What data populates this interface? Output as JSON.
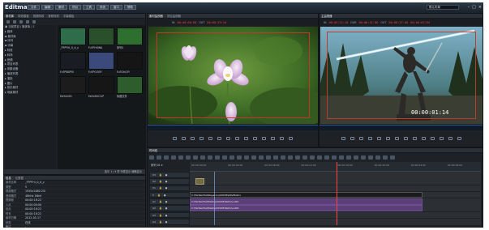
{
  "titlebar": {
    "app_name": "Editmax",
    "menus": [
      "文件",
      "编辑",
      "素材",
      "项目",
      "工具",
      "系统",
      "窗口",
      "帮助"
    ],
    "layout_select": "默认布局",
    "window_controls": [
      "–",
      "□",
      "×"
    ]
  },
  "library": {
    "tabs": [
      "素材库",
      "特效模板",
      "视频特效",
      "音频特效",
      "字幕模板"
    ],
    "tree": [
      "▣ 当前项目 / 媒体库 / 1",
      "  ▸ 媒体",
      "    ▪ 素材库",
      "    ▪ 序列",
      "    ▪ 字幕",
      "  ▸ 特效",
      "  ▸ 转场",
      "  ▸ 音频",
      "▸ 项目列表",
      "▸ 采集设备",
      "▸ 播放列表",
      "▸ 渲染",
      "▸ 图片",
      "▸ 音乐素材",
      "▸ 场景素材"
    ],
    "thumbs": [
      {
        "label": "_P?PFHi_0_d_y",
        "color": "#2f6c4a"
      },
      {
        "label": "Fu?PHi0NA",
        "color": "#2a4f2b"
      },
      {
        "label": "序列1",
        "color": "#2e6e2e"
      },
      {
        "label": "Fu?Pi80Pi0",
        "color": "#1a1c24"
      },
      {
        "label": "Fu?PGi30F",
        "color": "#3b4a7a"
      },
      {
        "label": "Fu?Ghi1Pi",
        "color": "#151515"
      },
      {
        "label": "FaHnhi01",
        "color": "#1c1c1c"
      },
      {
        "label": "FaHnHih21P",
        "color": "#161616"
      },
      {
        "label": "标题文件",
        "color": "#2d5c2d"
      }
    ],
    "status": "选中 1 / 9 项  列表显示  缩略显示"
  },
  "properties": {
    "tabs": [
      "信息",
      "元数据"
    ],
    "rows": [
      {
        "k": "素材名称",
        "v": "_P?PFHi_0_d_y"
      },
      {
        "k": "类型",
        "v": "V"
      },
      {
        "k": "视频格式",
        "v": "1920x1080 25i"
      },
      {
        "k": "音频格式",
        "v": "48kHz 16bit"
      },
      {
        "k": "视频帧",
        "v": "00:00:18:22"
      },
      {
        "k": "入点",
        "v": "00:00:00:00"
      },
      {
        "k": "出点",
        "v": "00:00:18:22"
      },
      {
        "k": "时长",
        "v": "00:00:18:22"
      },
      {
        "k": "素材日期",
        "v": "2012-05-17"
      },
      {
        "k": "状态",
        "v": "在线"
      },
      {
        "k": "备注",
        "v": "-"
      }
    ]
  },
  "source": {
    "tabs": [
      "素材监视器",
      "项目监视器"
    ],
    "tc_in_label": "IN",
    "tc_in": "00:00:00:00",
    "tc_out_label": "OUT",
    "tc_out": "00:00:33:16"
  },
  "record": {
    "tabs": [
      "主监视器"
    ],
    "tc_in_label": "IN",
    "tc_in": "00:03:22:10",
    "tc_mid_label": "DUR",
    "tc_mid": "00:00:31:06",
    "tc_out_label": "OUT",
    "tc_out": "00:00:37:00",
    "tc_extra": "00:00:03:04",
    "overlay_tc": "00:00:01:14"
  },
  "timeline": {
    "tab": "时间线",
    "sequence": "序列 01 ▾",
    "ruler_ticks": [
      "00:00:00:00",
      "00:00:04:00",
      "00:00:08:00",
      "00:00:12:00",
      "00:00:16:00",
      "00:00:20:00",
      "00:00:24:00",
      "00:00:28:00"
    ],
    "tracks": [
      {
        "name": "V3",
        "clips": []
      },
      {
        "name": "V2",
        "clips": [
          {
            "label": "",
            "style": "thumb",
            "start": 2,
            "width": 3
          }
        ]
      },
      {
        "name": "V1",
        "clips": []
      },
      {
        "name": "V",
        "clips": [
          {
            "label": "C:\\FarRenPlat\\Regerics\\00005\\NAVMatrix",
            "style": "dark",
            "start": 0,
            "width": 80
          }
        ]
      },
      {
        "name": "A1",
        "clips": [
          {
            "label": "C:\\FarRenPlat\\Media\\00005\\NAV\\Aud01",
            "style": "audio",
            "start": 0,
            "width": 80
          }
        ]
      },
      {
        "name": "A2",
        "clips": [
          {
            "label": "C:\\FarRenPlat\\Media\\00005\\NAV\\Aud02",
            "style": "audio",
            "start": 0,
            "width": 80
          }
        ]
      },
      {
        "name": "A3",
        "clips": []
      },
      {
        "name": "A4",
        "clips": []
      }
    ],
    "playhead_fraction": 0.5
  }
}
